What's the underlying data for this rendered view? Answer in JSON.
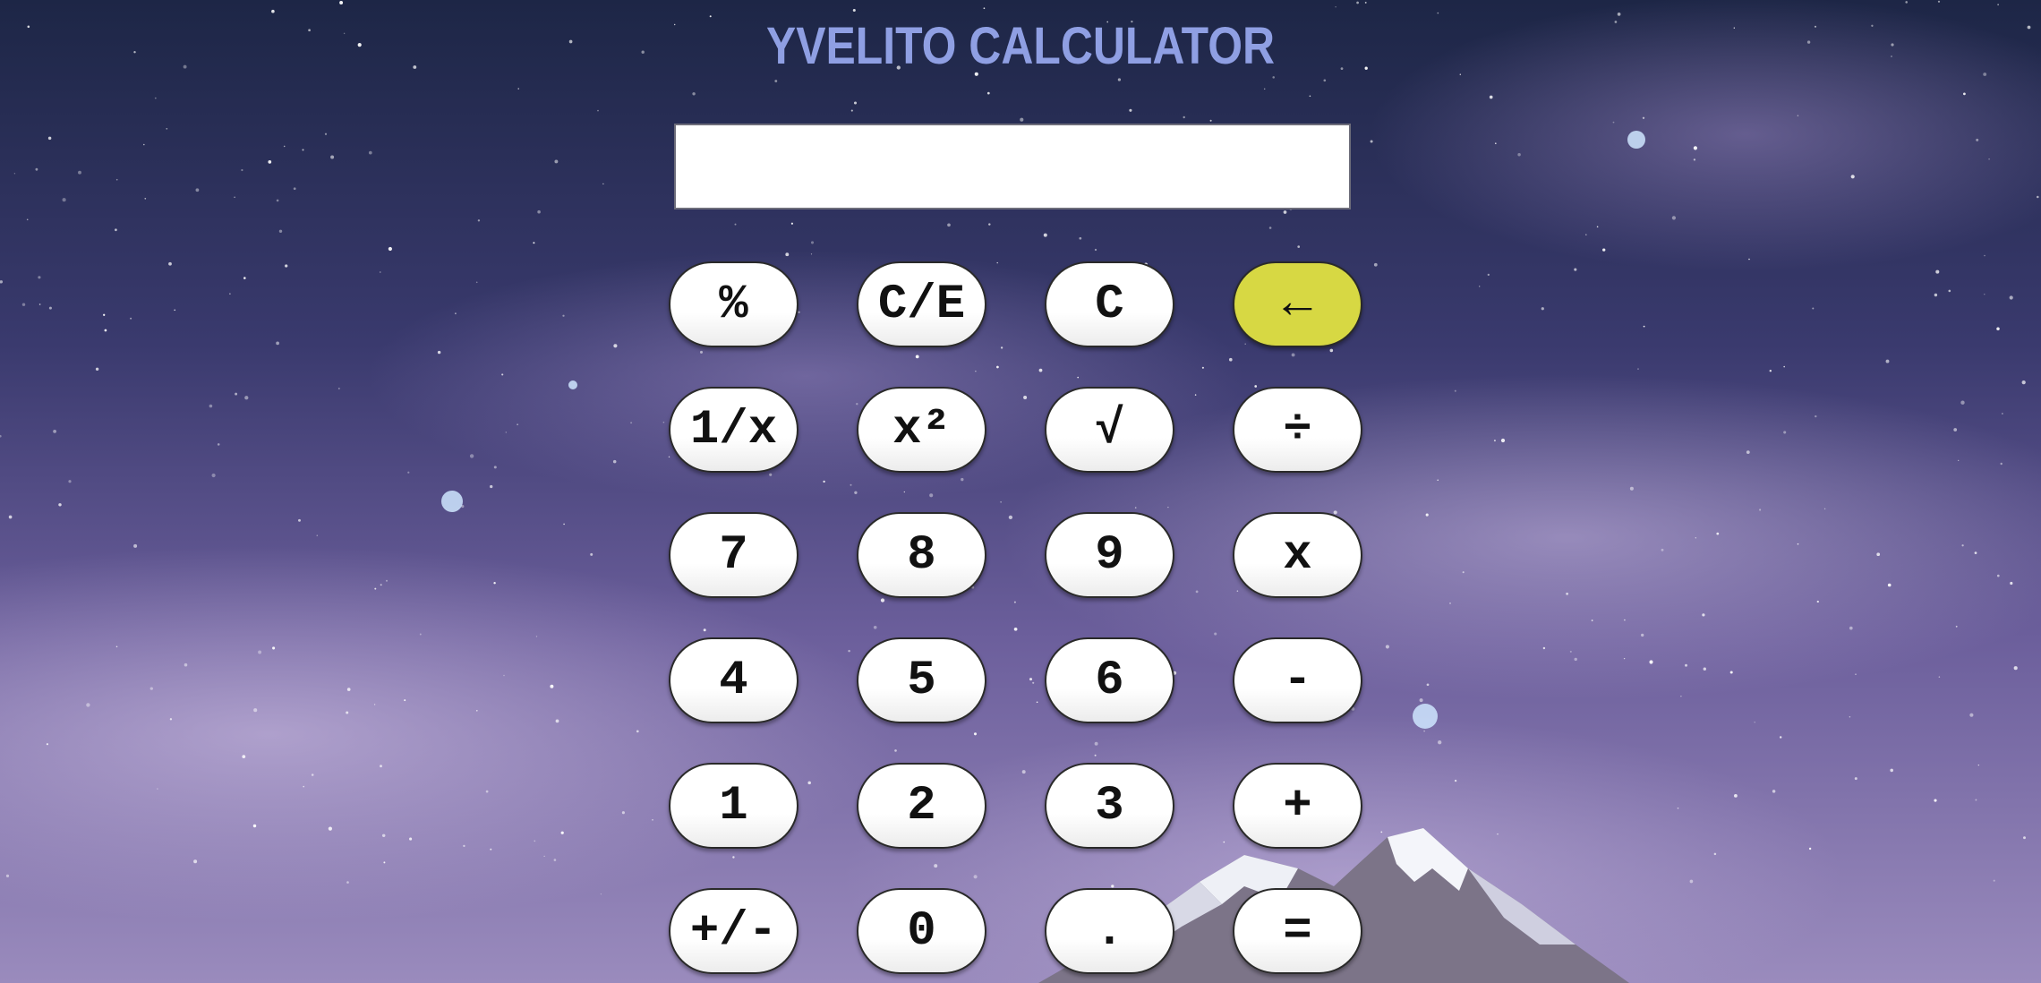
{
  "app": {
    "title": "YVELITO CALCULATOR"
  },
  "display": {
    "value": ""
  },
  "colors": {
    "title": "#8f9fe3",
    "key_background": "#ffffff",
    "backspace_accent": "#d7d843",
    "key_border": "#2a2a2a"
  },
  "keys": [
    {
      "label": "%",
      "icon": "percent"
    },
    {
      "label": "C/E"
    },
    {
      "label": "C"
    },
    {
      "label": "←",
      "icon": "backspace-arrow-icon"
    },
    {
      "label": "1/x"
    },
    {
      "label": "x²"
    },
    {
      "label": "√"
    },
    {
      "label": "÷"
    },
    {
      "label": "7"
    },
    {
      "label": "8"
    },
    {
      "label": "9"
    },
    {
      "label": "x"
    },
    {
      "label": "4"
    },
    {
      "label": "5"
    },
    {
      "label": "6"
    },
    {
      "label": "-"
    },
    {
      "label": "1"
    },
    {
      "label": "2"
    },
    {
      "label": "3"
    },
    {
      "label": "+"
    },
    {
      "label": "+/-"
    },
    {
      "label": "0"
    },
    {
      "label": "."
    },
    {
      "label": "="
    }
  ]
}
